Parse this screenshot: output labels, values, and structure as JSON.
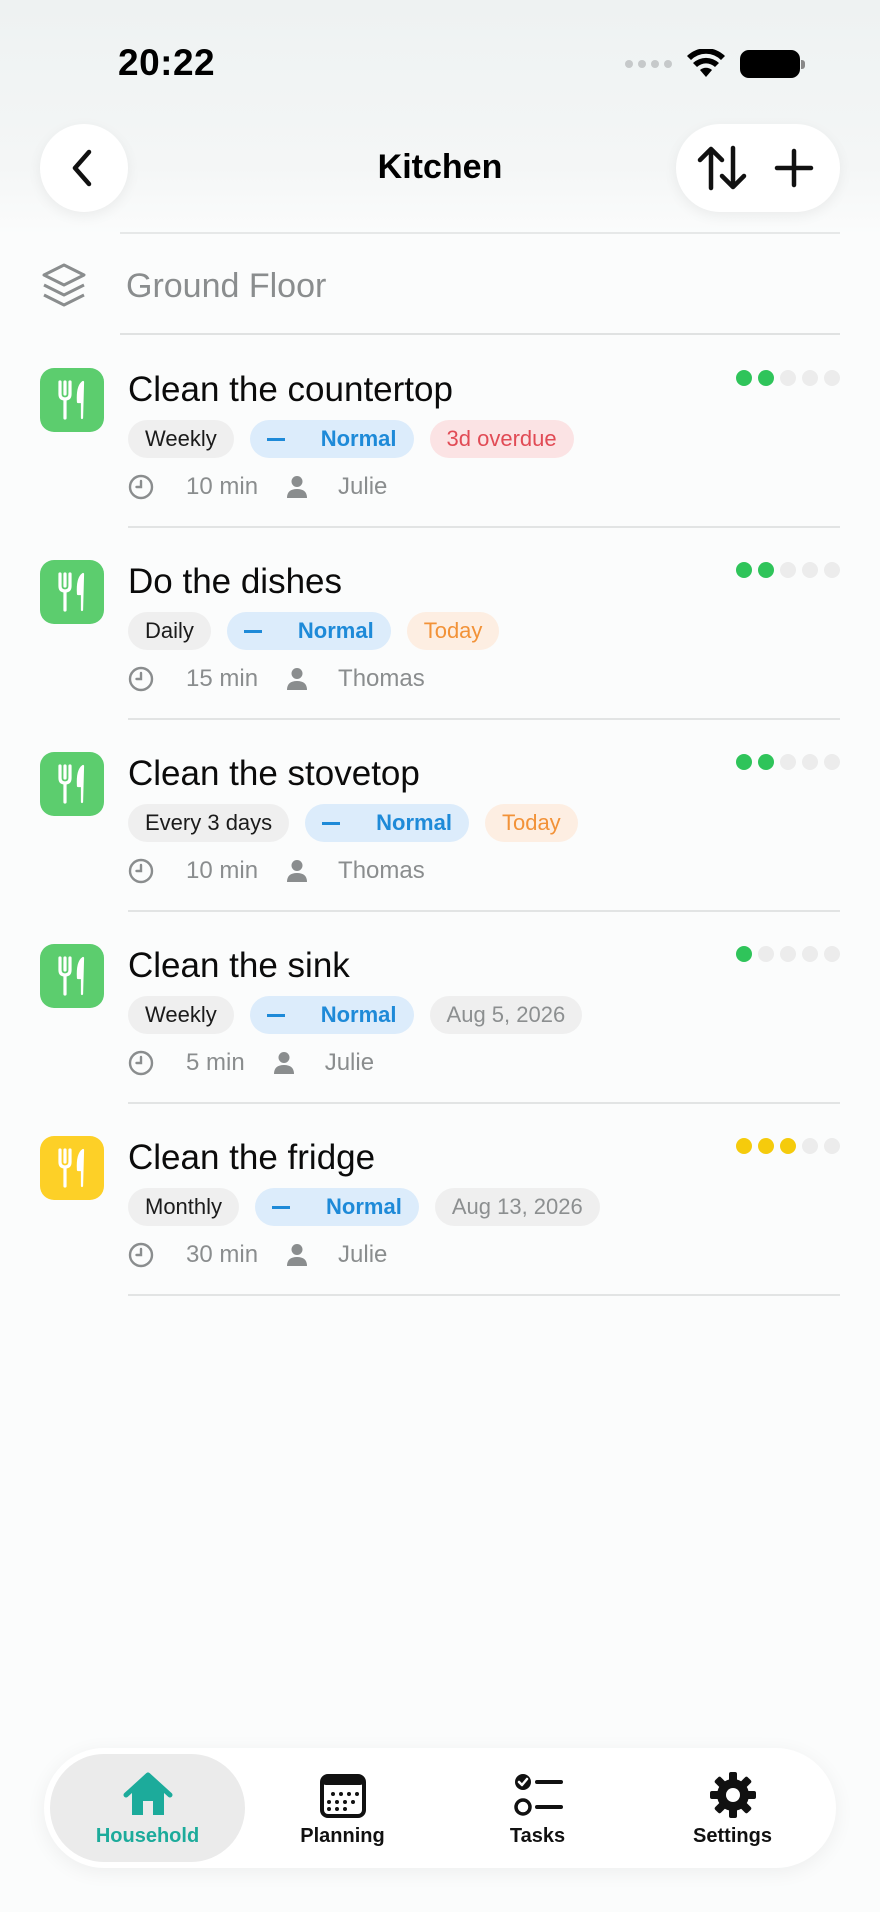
{
  "status_bar": {
    "time": "20:22"
  },
  "header": {
    "title": "Kitchen",
    "back_icon": "chevron-left-icon",
    "sort_icon": "sort-arrows-icon",
    "add_icon": "plus-icon"
  },
  "floor": {
    "label": "Ground Floor",
    "icon": "layers-icon"
  },
  "colors": {
    "accent": "#1cab9b",
    "green": "#5ccd6e",
    "yellow": "#fdd027",
    "priority_blue": "#1e8ad8",
    "overdue_red": "#e14b55",
    "today_orange": "#f29238"
  },
  "tasks": [
    {
      "title": "Clean the countertop",
      "frequency": "Weekly",
      "priority": "Normal",
      "status": "3d overdue",
      "status_type": "overdue",
      "duration": "10 min",
      "assignee": "Julie",
      "effort_level": 2,
      "effort_max": 5,
      "effort_color": "#2fc45a",
      "icon_color": "#5ccd6e",
      "icon": "fork-knife-icon"
    },
    {
      "title": "Do the dishes",
      "frequency": "Daily",
      "priority": "Normal",
      "status": "Today",
      "status_type": "today",
      "duration": "15 min",
      "assignee": "Thomas",
      "effort_level": 2,
      "effort_max": 5,
      "effort_color": "#2fc45a",
      "icon_color": "#5ccd6e",
      "icon": "fork-knife-icon"
    },
    {
      "title": "Clean the stovetop",
      "frequency": "Every 3 days",
      "priority": "Normal",
      "status": "Today",
      "status_type": "today",
      "duration": "10 min",
      "assignee": "Thomas",
      "effort_level": 2,
      "effort_max": 5,
      "effort_color": "#2fc45a",
      "icon_color": "#5ccd6e",
      "icon": "fork-knife-icon"
    },
    {
      "title": "Clean the sink",
      "frequency": "Weekly",
      "priority": "Normal",
      "status": "Aug 5, 2026",
      "status_type": "date",
      "duration": "5 min",
      "assignee": "Julie",
      "effort_level": 1,
      "effort_max": 5,
      "effort_color": "#2fc45a",
      "icon_color": "#5ccd6e",
      "icon": "fork-knife-icon"
    },
    {
      "title": "Clean the fridge",
      "frequency": "Monthly",
      "priority": "Normal",
      "status": "Aug 13, 2026",
      "status_type": "date",
      "duration": "30 min",
      "assignee": "Julie",
      "effort_level": 3,
      "effort_max": 5,
      "effort_color": "#f5cb0c",
      "icon_color": "#fdd027",
      "icon": "fork-knife-icon"
    }
  ],
  "nav": {
    "items": [
      {
        "label": "Household",
        "icon": "house-icon",
        "active": true
      },
      {
        "label": "Planning",
        "icon": "calendar-icon",
        "active": false
      },
      {
        "label": "Tasks",
        "icon": "checklist-icon",
        "active": false
      },
      {
        "label": "Settings",
        "icon": "gear-icon",
        "active": false
      }
    ]
  }
}
